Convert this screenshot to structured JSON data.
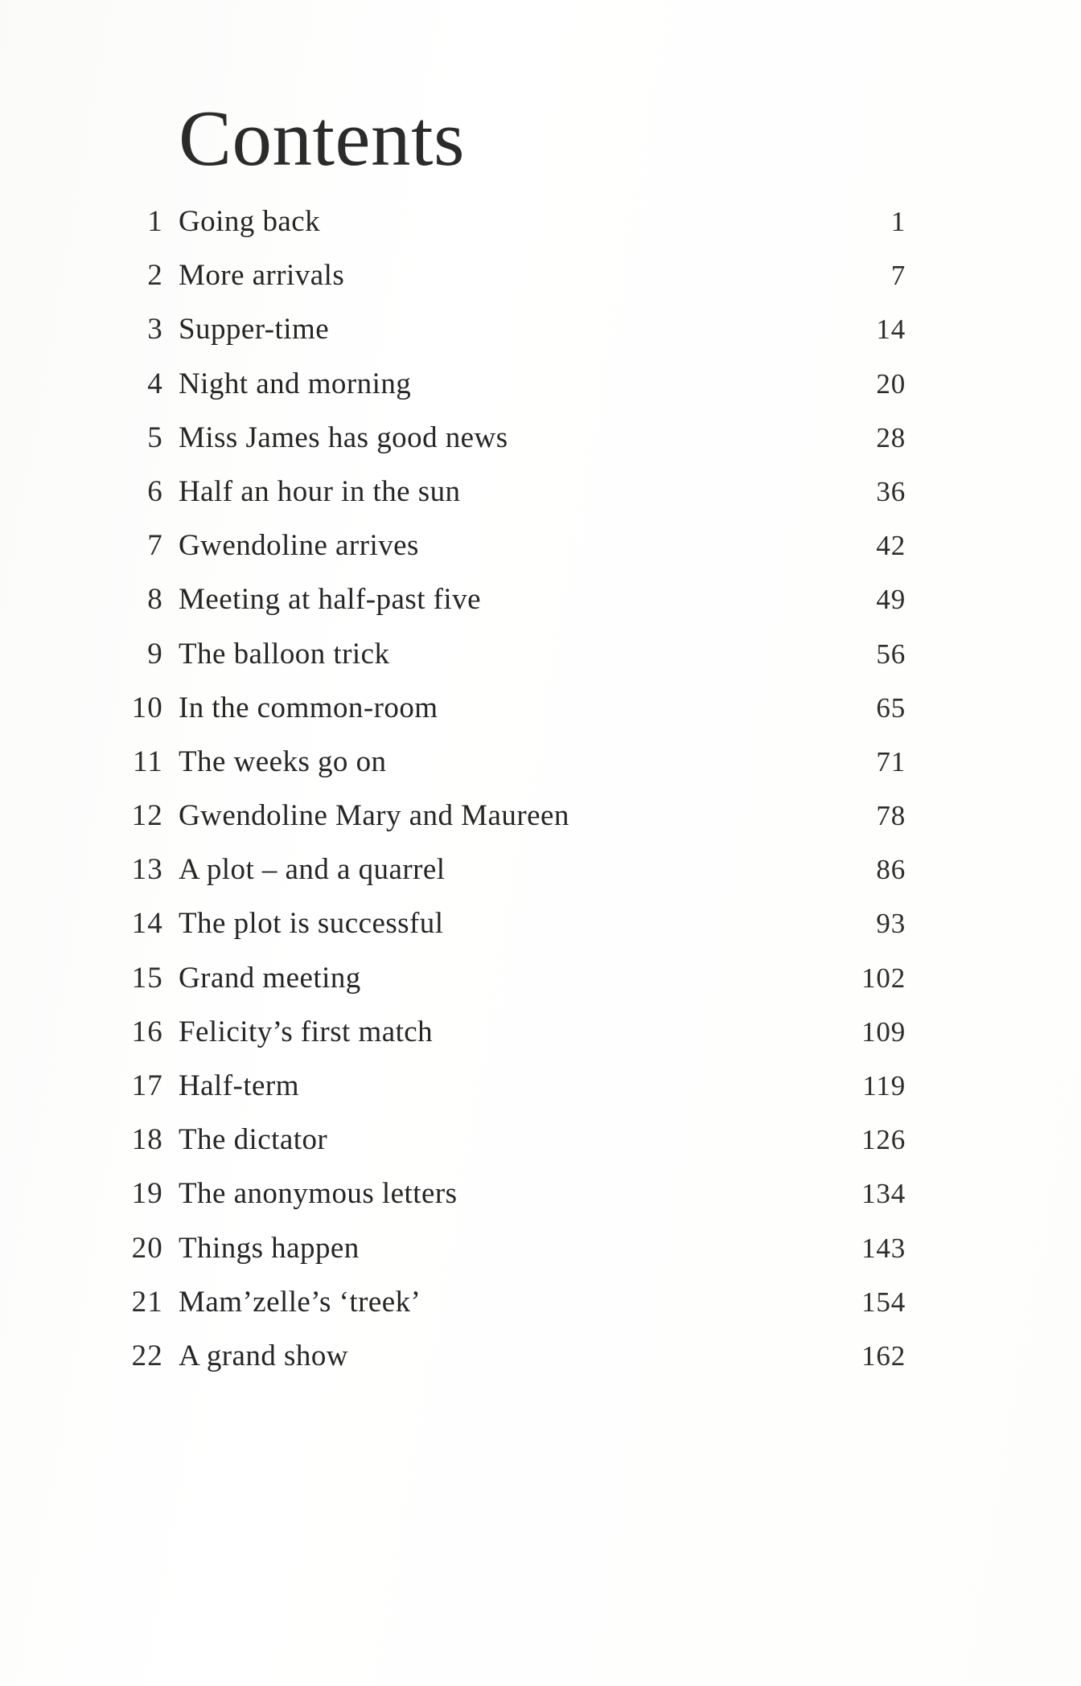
{
  "document": {
    "kind": "book-table-of-contents",
    "heading": "Contents",
    "background_color": "#ffffff",
    "text_color": "#2a2a2a"
  },
  "columns": {
    "chapter_number": "",
    "chapter_title": "",
    "page_number": ""
  },
  "entries": [
    {
      "number": "1",
      "title": "Going back",
      "page": "1"
    },
    {
      "number": "2",
      "title": "More arrivals",
      "page": "7"
    },
    {
      "number": "3",
      "title": "Supper-time",
      "page": "14"
    },
    {
      "number": "4",
      "title": "Night and morning",
      "page": "20"
    },
    {
      "number": "5",
      "title": "Miss James has good news",
      "page": "28"
    },
    {
      "number": "6",
      "title": "Half an hour in the sun",
      "page": "36"
    },
    {
      "number": "7",
      "title": "Gwendoline arrives",
      "page": "42"
    },
    {
      "number": "8",
      "title": "Meeting at half-past five",
      "page": "49"
    },
    {
      "number": "9",
      "title": "The balloon trick",
      "page": "56"
    },
    {
      "number": "10",
      "title": "In the common-room",
      "page": "65"
    },
    {
      "number": "11",
      "title": "The weeks go on",
      "page": "71"
    },
    {
      "number": "12",
      "title": "Gwendoline Mary and Maureen",
      "page": "78"
    },
    {
      "number": "13",
      "title": "A plot – and a quarrel",
      "page": "86"
    },
    {
      "number": "14",
      "title": "The plot is successful",
      "page": "93"
    },
    {
      "number": "15",
      "title": "Grand meeting",
      "page": "102"
    },
    {
      "number": "16",
      "title": "Felicity’s first match",
      "page": "109"
    },
    {
      "number": "17",
      "title": "Half-term",
      "page": "119"
    },
    {
      "number": "18",
      "title": "The dictator",
      "page": "126"
    },
    {
      "number": "19",
      "title": "The anonymous letters",
      "page": "134"
    },
    {
      "number": "20",
      "title": "Things happen",
      "page": "143"
    },
    {
      "number": "21",
      "title": "Mam’zelle’s ‘treek’",
      "page": "154"
    },
    {
      "number": "22",
      "title": "A grand show",
      "page": "162"
    }
  ]
}
